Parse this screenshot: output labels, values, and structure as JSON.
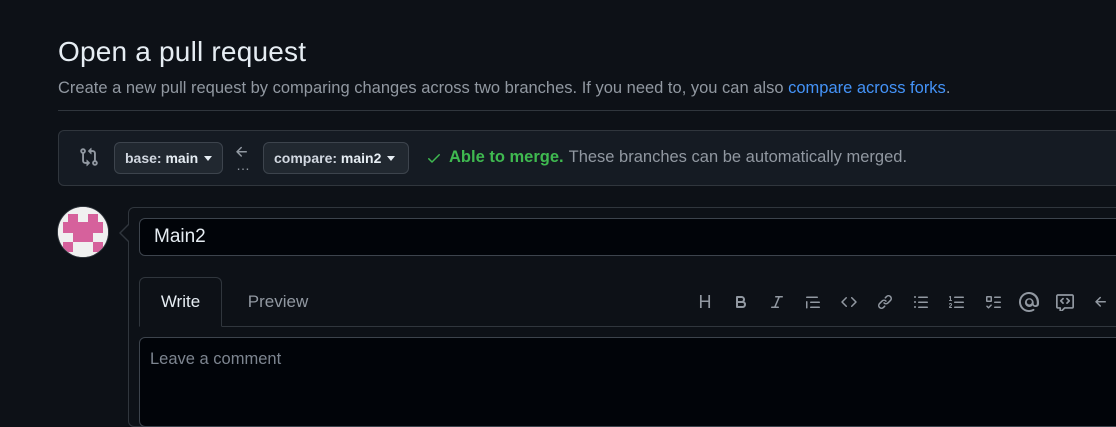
{
  "page": {
    "title": "Open a pull request",
    "subtitle_text": "Create a new pull request by comparing changes across two branches. If you need to, you can also ",
    "subtitle_link": "compare across forks",
    "subtitle_end": "."
  },
  "range": {
    "compare_icon": "git-compare-icon",
    "base_key": "base:",
    "base_value": "main",
    "arrow_icon": "arrow-left-icon",
    "ellipsis": "…",
    "compare_key": "compare:",
    "compare_value": "main2",
    "merge_ok": "Able to merge.",
    "merge_msg": "These branches can be automatically merged."
  },
  "composer": {
    "title_value": "Main2",
    "tabs": [
      {
        "label": "Write",
        "active": true
      },
      {
        "label": "Preview",
        "active": false
      }
    ],
    "toolbar": {
      "heading": "H",
      "icons": [
        "heading-icon",
        "bold-icon",
        "italic-icon",
        "quote-icon",
        "code-icon",
        "link-icon",
        "unordered-list-icon",
        "ordered-list-icon",
        "task-list-icon",
        "mention-icon",
        "reference-icon",
        "undo-icon"
      ]
    },
    "comment_placeholder": "Leave a comment"
  },
  "colors": {
    "background": "#0d1117",
    "link": "#4493f8",
    "success": "#3fb950",
    "muted": "#9198a1",
    "avatar_pink": "#d6619c"
  }
}
